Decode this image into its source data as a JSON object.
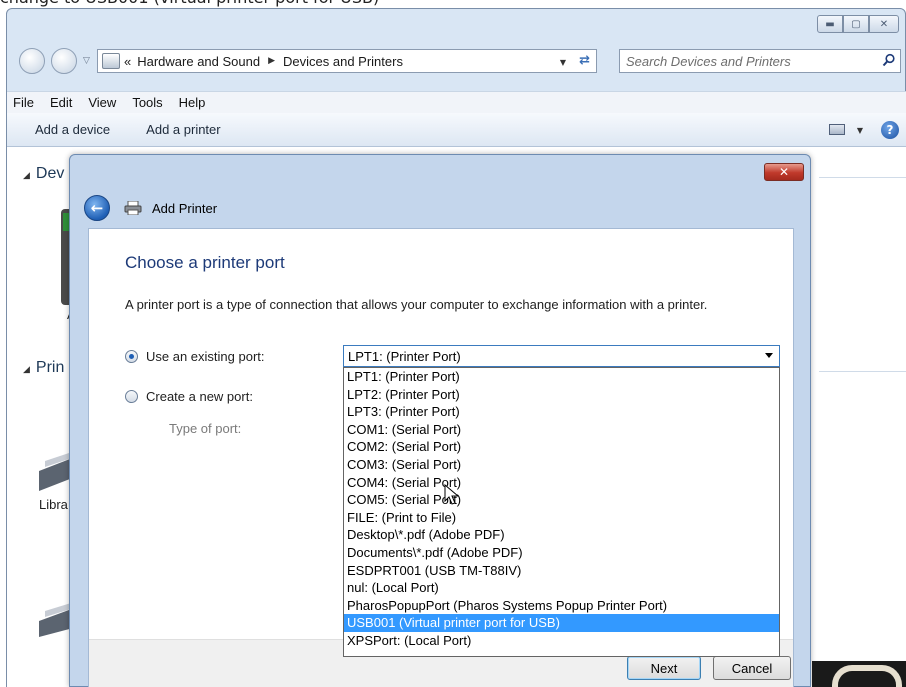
{
  "caption": "change to USB001 (virtual printer port for USB)",
  "explorer": {
    "breadcrumb": [
      "Hardware and Sound",
      "Devices and Printers"
    ],
    "breadcrumb_prefix": "«",
    "search_placeholder": "Search Devices and Printers",
    "menu": [
      "File",
      "Edit",
      "View",
      "Tools",
      "Help"
    ],
    "commands": [
      "Add a device",
      "Add a printer"
    ],
    "groups": [
      "Dev",
      "Prin"
    ],
    "device_labels": [
      "A",
      "Libra"
    ]
  },
  "dialog": {
    "title": "Add Printer",
    "heading": "Choose a printer port",
    "description": "A printer port is a type of connection that allows your computer to exchange information with a printer.",
    "use_existing_label": "Use an existing port:",
    "create_new_label": "Create a new port:",
    "type_of_port_label": "Type of port:",
    "selected_port": "LPT1: (Printer Port)",
    "port_options": [
      "LPT1: (Printer Port)",
      "LPT2: (Printer Port)",
      "LPT3: (Printer Port)",
      "COM1: (Serial Port)",
      "COM2: (Serial Port)",
      "COM3: (Serial Port)",
      "COM4: (Serial Port)",
      "COM5: (Serial Port)",
      "FILE: (Print to File)",
      "Desktop\\*.pdf (Adobe PDF)",
      "Documents\\*.pdf (Adobe PDF)",
      "ESDPRT001 (USB TM-T88IV)",
      "nul: (Local Port)",
      "PharosPopupPort (Pharos Systems Popup Printer Port)",
      "USB001 (Virtual printer port for USB)",
      "XPSPort: (Local Port)"
    ],
    "highlighted_index": 14,
    "next_label": "Next",
    "cancel_label": "Cancel",
    "close_glyph": "✕"
  },
  "colors": {
    "highlight": "#3399ff",
    "heading": "#1d3a78",
    "close_red": "#c0392b"
  }
}
